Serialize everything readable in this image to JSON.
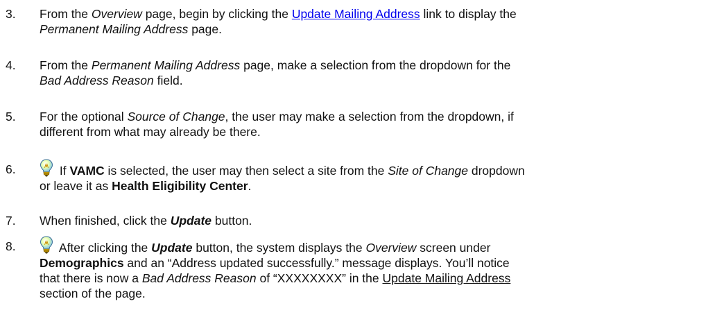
{
  "steps": [
    {
      "number": "3.",
      "parts": {
        "a": "From the ",
        "b": "Overview",
        "c": " page, begin by clicking the ",
        "link": "Update Mailing Address",
        "d": " link to display the",
        "e": "Permanent Mailing Address",
        "f": " page."
      }
    },
    {
      "number": "4.",
      "parts": {
        "a": "From the ",
        "b": "Permanent Mailing Address",
        "c": " page, make a selection from the dropdown for the",
        "d": "Bad Address Reason",
        "e": " field."
      }
    },
    {
      "number": "5.",
      "parts": {
        "a": "For the optional ",
        "b": "Source of Change",
        "c": ", the user may make a selection from the dropdown, if",
        "d": "different from what may already be there."
      }
    },
    {
      "number": "6.",
      "icon": "lightbulb-tip-icon",
      "parts": {
        "a": " If ",
        "b": "VAMC",
        "c": " is selected, the user may then select a site from the ",
        "d": "Site of Change",
        "e": " dropdown",
        "f": "or leave it as ",
        "g": "Health Eligibility Center",
        "h": "."
      }
    },
    {
      "number": "7.",
      "parts": {
        "a": "When finished, click the ",
        "b": "Update",
        "c": " button."
      }
    },
    {
      "number": "8.",
      "icon": "lightbulb-tip-icon",
      "parts": {
        "a": " After clicking the ",
        "b": "Update",
        "c": " button, the system displays the ",
        "d": "Overview",
        "e": " screen under",
        "f": "Demographics",
        "g": " and an “Address updated successfully.” message displays.  You’ll notice",
        "h": "that there is now a ",
        "i": "Bad Address Reason",
        "j": " of “XXXXXXXX” in the ",
        "k": "Update Mailing Address",
        "l": "section of the page."
      }
    }
  ]
}
